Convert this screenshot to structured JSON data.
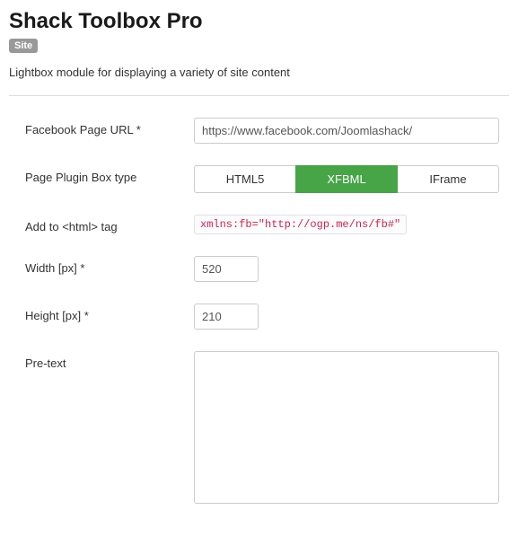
{
  "header": {
    "title": "Shack Toolbox Pro",
    "badge": "Site",
    "description": "Lightbox module for displaying a variety of site content"
  },
  "form": {
    "fb_url": {
      "label": "Facebook Page URL *",
      "value": "https://www.facebook.com/Joomlashack/"
    },
    "box_type": {
      "label": "Page Plugin Box type",
      "options": [
        "HTML5",
        "XFBML",
        "IFrame"
      ],
      "selected": "XFBML"
    },
    "html_tag": {
      "label": "Add to <html> tag",
      "code": "xmlns:fb=\"http://ogp.me/ns/fb#\""
    },
    "width": {
      "label": "Width [px] *",
      "value": "520"
    },
    "height": {
      "label": "Height [px] *",
      "value": "210"
    },
    "pretext": {
      "label": "Pre-text",
      "value": ""
    }
  }
}
